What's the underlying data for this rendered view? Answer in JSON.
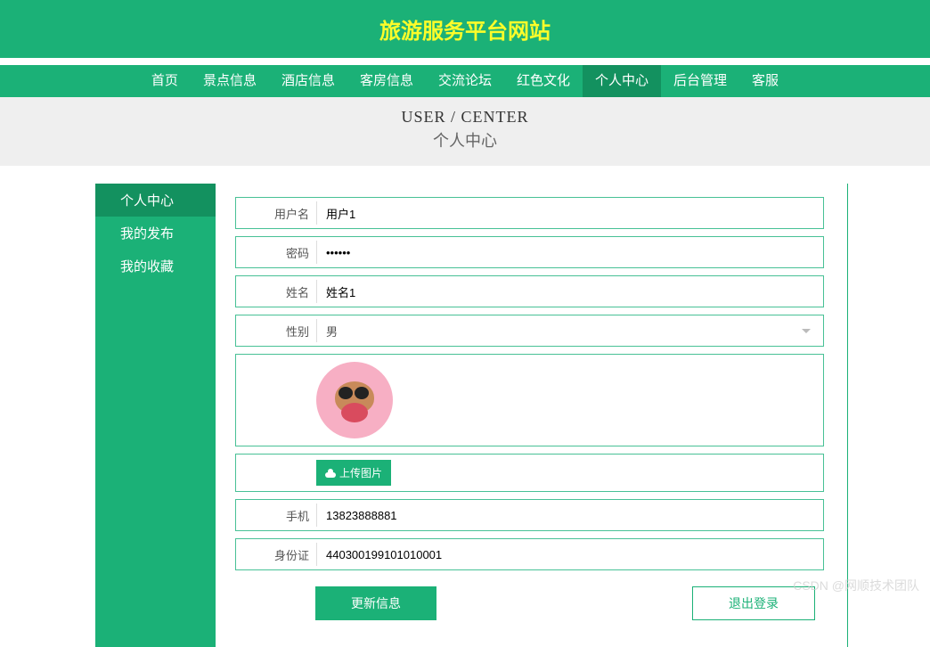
{
  "header": {
    "title": "旅游服务平台网站"
  },
  "nav": {
    "items": [
      "首页",
      "景点信息",
      "酒店信息",
      "客房信息",
      "交流论坛",
      "红色文化",
      "个人中心",
      "后台管理",
      "客服"
    ],
    "active_index": 6
  },
  "page_header": {
    "title_en": "USER / CENTER",
    "title_cn": "个人中心"
  },
  "sidebar": {
    "items": [
      "个人中心",
      "我的发布",
      "我的收藏"
    ],
    "active_index": 0
  },
  "form": {
    "username_label": "用户名",
    "username_value": "用户1",
    "password_label": "密码",
    "password_value": "••••••",
    "name_label": "姓名",
    "name_value": "姓名1",
    "gender_label": "性别",
    "gender_value": "男",
    "upload_label": "上传图片",
    "phone_label": "手机",
    "phone_value": "13823888881",
    "idcard_label": "身份证",
    "idcard_value": "440300199101010001"
  },
  "actions": {
    "update": "更新信息",
    "logout": "退出登录"
  },
  "watermark": "CSDN @网顺技术团队"
}
